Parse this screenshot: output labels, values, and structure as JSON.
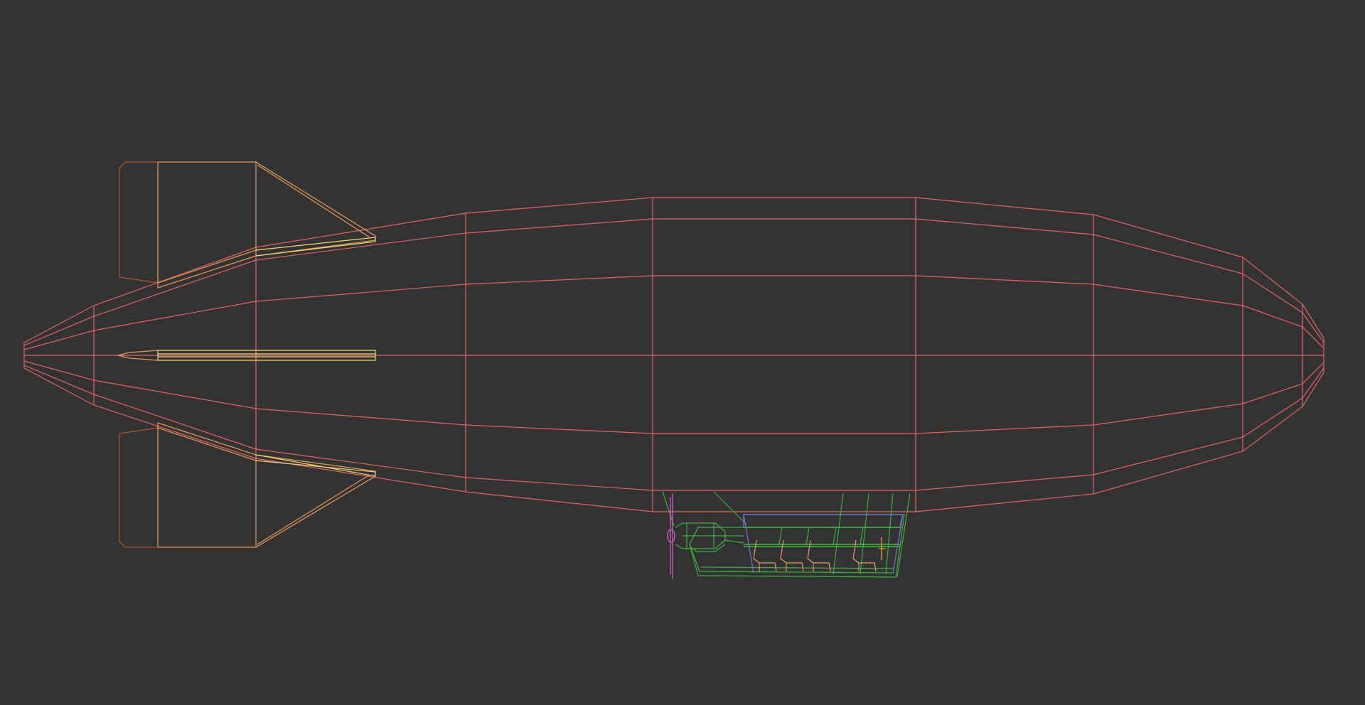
{
  "viewport": {
    "background": "#333333",
    "view": "wireframe",
    "subject": "blimp"
  },
  "colors": {
    "hull": "#e06464",
    "fin": "#e3995a",
    "fin_dark": "#a9552d",
    "fin_light": "#f0d77a",
    "gondola": "#3fae3f",
    "gondola_bright": "#49d349",
    "cabin": "#7b6fd6",
    "prop": "#e05fd2",
    "seat": "#e39a6b",
    "pilot": "#f0b21e"
  },
  "icons": {
    "propeller": "propeller-icon",
    "seat": "seat-icon"
  },
  "seats": {
    "count": 4
  }
}
